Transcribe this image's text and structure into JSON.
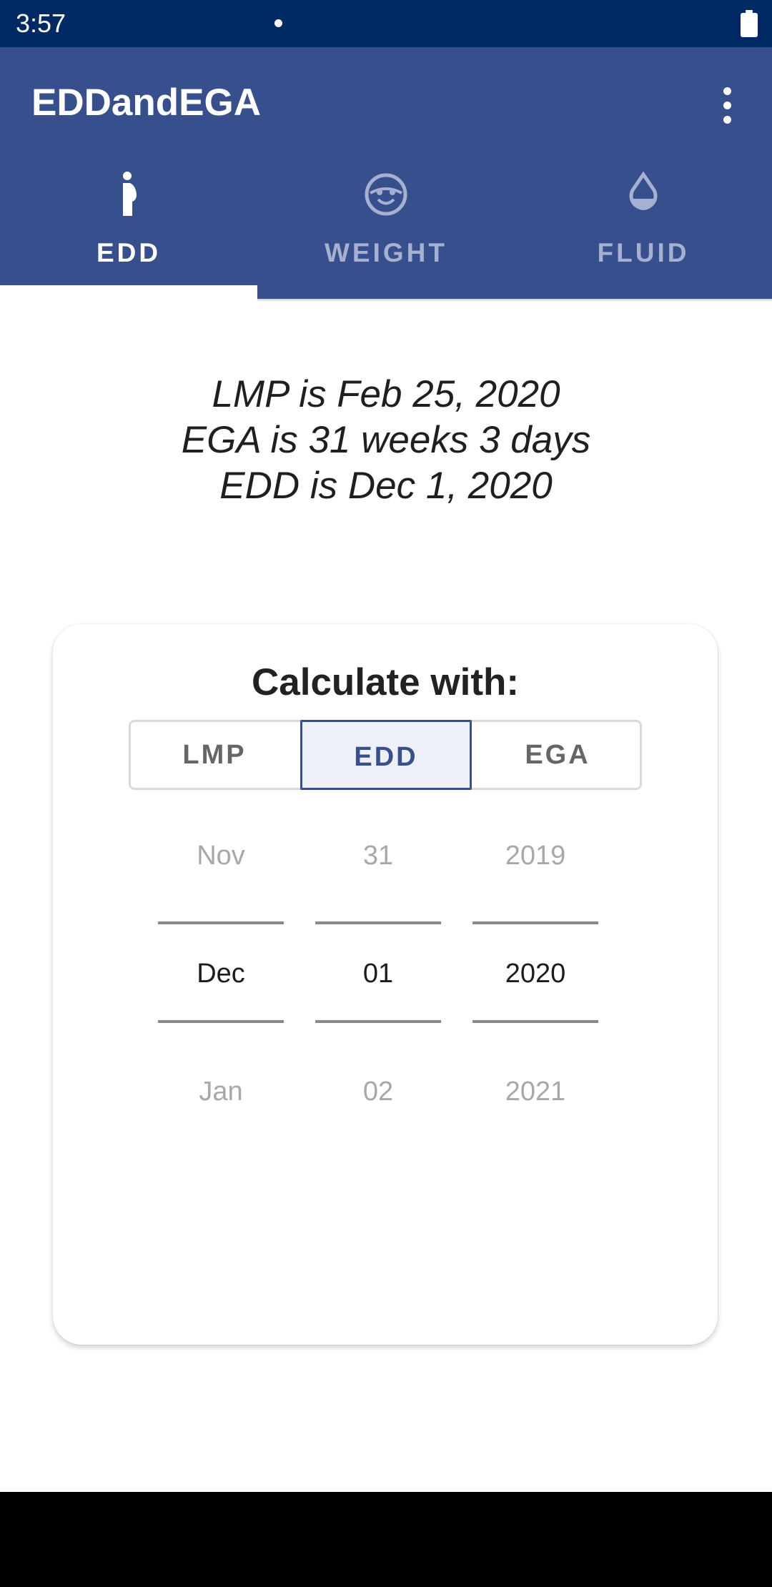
{
  "status_bar": {
    "time": "3:57",
    "icons": [
      "notification-dot",
      "battery-icon"
    ]
  },
  "app_bar": {
    "title": "EDDandEGA",
    "menu_icon": "more-vertical-icon",
    "background": "#384f8d"
  },
  "tabs": [
    {
      "label": "EDD",
      "icon": "pregnant-person-icon",
      "selected": true
    },
    {
      "label": "WEIGHT",
      "icon": "baby-face-icon",
      "selected": false
    },
    {
      "label": "FLUID",
      "icon": "water-drop-icon",
      "selected": false
    }
  ],
  "summary": {
    "lmp_line": "LMP is Feb 25, 2020",
    "ega_line": "EGA is 31 weeks 3 days",
    "edd_line": "EDD is Dec 1, 2020"
  },
  "card": {
    "title": "Calculate with:",
    "segments": [
      {
        "label": "LMP",
        "selected": false
      },
      {
        "label": "EDD",
        "selected": true
      },
      {
        "label": "EGA",
        "selected": false
      }
    ],
    "picker": {
      "month": {
        "prev": "Nov",
        "selected": "Dec",
        "next": "Jan"
      },
      "day": {
        "prev": "31",
        "selected": "01",
        "next": "02"
      },
      "year": {
        "prev": "2019",
        "selected": "2020",
        "next": "2021"
      }
    }
  },
  "colors": {
    "status_bar": "#012964",
    "accent": "#384f8d",
    "tab_inactive": "#a6b1d2",
    "segment_selected_bg": "#edf0f6"
  }
}
